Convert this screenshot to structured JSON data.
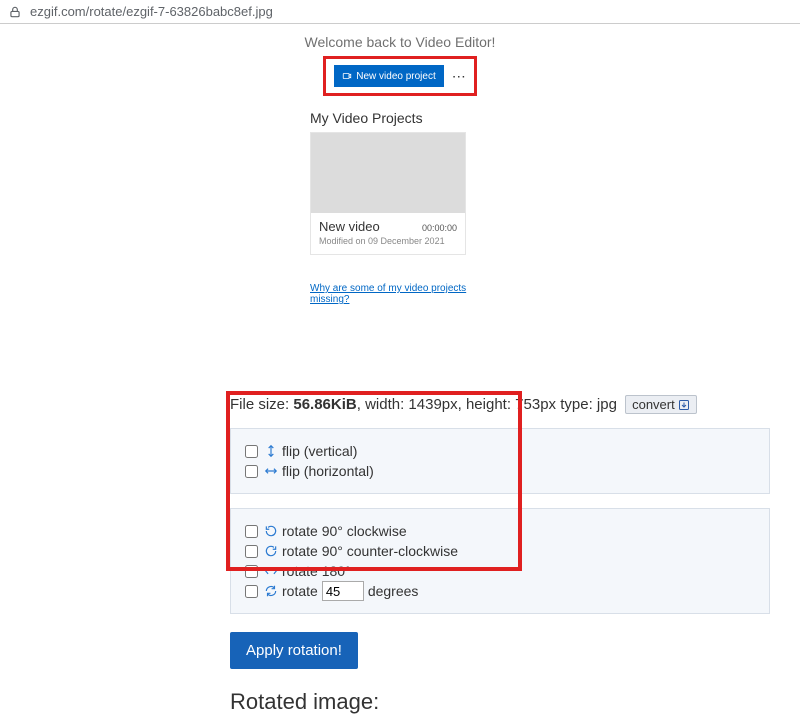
{
  "address_bar": {
    "url": "ezgif.com/rotate/ezgif-7-63826babc8ef.jpg"
  },
  "video_editor": {
    "welcome": "Welcome back to Video Editor!",
    "new_project_label": "New video project",
    "section_title": "My Video Projects",
    "project": {
      "name": "New video",
      "duration": "00:00:00",
      "modified": "Modified on 09 December 2021"
    },
    "missing_link": "Why are some of my video projects missing?"
  },
  "file_info": {
    "label_prefix": "File size: ",
    "size": "56.86KiB",
    "width_label": ", width: 1439px, height: 753px",
    "type_label": " type: jpg",
    "convert_label": "convert"
  },
  "options": {
    "flip_vertical": "flip (vertical)",
    "flip_horizontal": "flip (horizontal)",
    "rotate_cw": "rotate 90° clockwise",
    "rotate_ccw": "rotate 90° counter-clockwise",
    "rotate_180": "rotate 180°",
    "rotate_custom_prefix": "rotate ",
    "rotate_custom_value": "45",
    "rotate_custom_suffix": " degrees"
  },
  "apply_label": "Apply rotation!",
  "rotated_heading": "Rotated image:"
}
